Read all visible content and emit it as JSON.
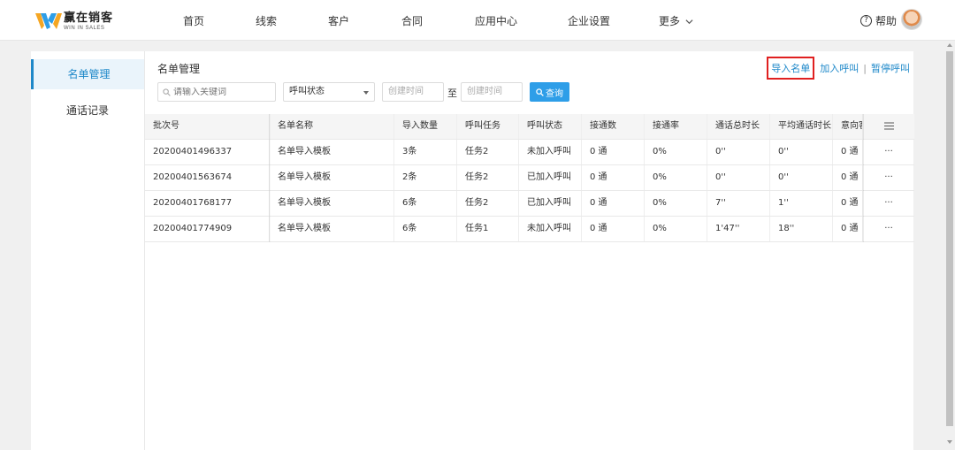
{
  "brand": {
    "name_cn": "赢在销客",
    "name_en": "WIN IN SALES",
    "logo_color": "#2e9ee8",
    "logo_accent": "#f5a623"
  },
  "nav": {
    "items": [
      "首页",
      "线索",
      "客户",
      "合同",
      "应用中心",
      "企业设置"
    ],
    "more": "更多",
    "help": "帮助"
  },
  "sidebar": {
    "items": [
      "名单管理",
      "通话记录"
    ],
    "active_index": 0
  },
  "main": {
    "title": "名单管理",
    "actions": {
      "import": "导入名单",
      "add_call": "加入呼叫",
      "pause_call": "暂停呼叫",
      "separator": "|"
    },
    "filters": {
      "search_placeholder": "请输入关键词",
      "call_status": "呼叫状态",
      "start_placeholder": "创建时间",
      "to": "至",
      "end_placeholder": "创建时间",
      "query": "查询"
    }
  },
  "table": {
    "columns": [
      "批次号",
      "名单名称",
      "导入数量",
      "呼叫任务",
      "呼叫状态",
      "接通数",
      "接通率",
      "通话总时长",
      "平均通话时长",
      "意向客"
    ],
    "rows": [
      [
        "20200401496337",
        "名单导入模板",
        "3条",
        "任务2",
        "未加入呼叫",
        "0 通",
        "0%",
        "0''",
        "0''",
        "0 通",
        "···"
      ],
      [
        "20200401563674",
        "名单导入模板",
        "2条",
        "任务2",
        "已加入呼叫",
        "0 通",
        "0%",
        "0''",
        "0''",
        "0 通",
        "···"
      ],
      [
        "20200401768177",
        "名单导入模板",
        "6条",
        "任务2",
        "已加入呼叫",
        "0 通",
        "0%",
        "7''",
        "1''",
        "0 通",
        "···"
      ],
      [
        "20200401774909",
        "名单导入模板",
        "6条",
        "任务1",
        "未加入呼叫",
        "0 通",
        "0%",
        "1'47''",
        "18''",
        "0 通",
        "···"
      ]
    ]
  },
  "colors": {
    "accent": "#1e88c9",
    "button": "#2e9ee8",
    "highlight_border": "#e02020",
    "header_bg": "#f5f5f5"
  }
}
